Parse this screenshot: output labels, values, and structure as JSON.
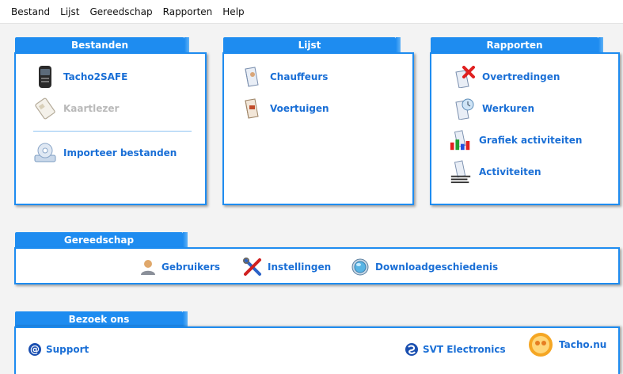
{
  "menu": {
    "items": [
      "Bestand",
      "Lijst",
      "Gereedschap",
      "Rapporten",
      "Help"
    ]
  },
  "bestanden": {
    "title": "Bestanden",
    "items": [
      {
        "label": "Tacho2SAFE",
        "icon": "tacho-device-icon",
        "enabled": true
      },
      {
        "label": "Kaartlezer",
        "icon": "card-reader-icon",
        "enabled": false
      },
      {
        "label": "Importeer bestanden",
        "icon": "import-disk-icon",
        "enabled": true
      }
    ]
  },
  "lijst": {
    "title": "Lijst",
    "items": [
      {
        "label": "Chauffeurs",
        "icon": "driver-book-icon"
      },
      {
        "label": "Voertuigen",
        "icon": "vehicle-book-icon"
      }
    ]
  },
  "rapporten": {
    "title": "Rapporten",
    "items": [
      {
        "label": "Overtredingen",
        "icon": "violation-icon"
      },
      {
        "label": "Werkuren",
        "icon": "work-hours-icon"
      },
      {
        "label": "Grafiek activiteiten",
        "icon": "activity-chart-icon"
      },
      {
        "label": "Activiteiten",
        "icon": "activities-icon"
      }
    ]
  },
  "gereedschap": {
    "title": "Gereedschap",
    "items": [
      {
        "label": "Gebruikers",
        "icon": "user-icon"
      },
      {
        "label": "Instellingen",
        "icon": "tools-icon"
      },
      {
        "label": "Downloadgeschiedenis",
        "icon": "download-history-icon"
      }
    ]
  },
  "bezoek": {
    "title": "Bezoek ons",
    "links": [
      {
        "label": "Support",
        "icon": "at-sign-icon"
      },
      {
        "label": "SVT Electronics",
        "icon": "svt-logo-icon"
      },
      {
        "label": "Tacho.nu",
        "icon": "tacho-nu-logo-icon"
      }
    ]
  },
  "colors": {
    "accent": "#1e8cf0",
    "link": "#1a6fd6",
    "disabled": "#b9b9b9"
  }
}
